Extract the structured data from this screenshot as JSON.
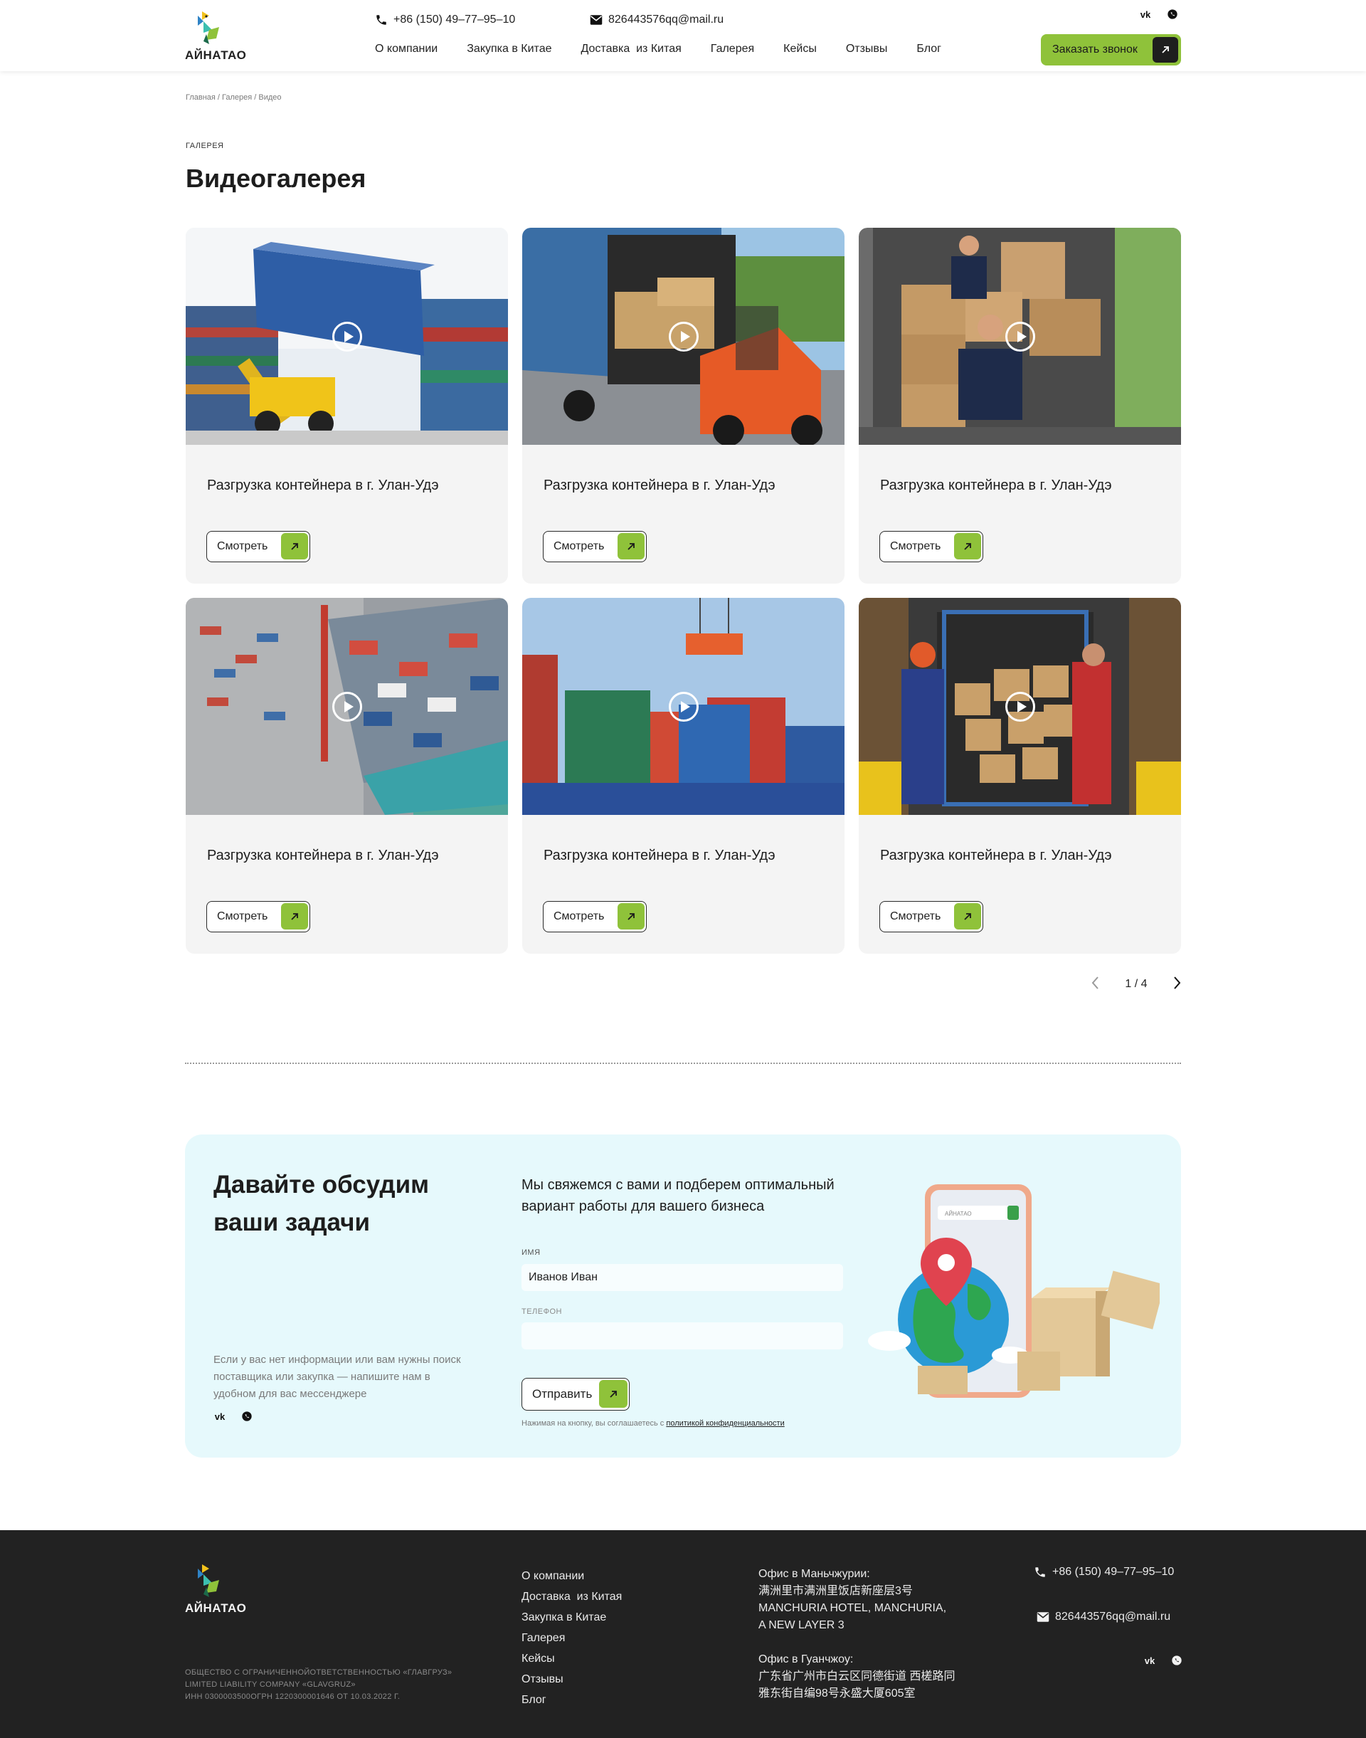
{
  "header": {
    "logo_text": "АЙНАТАО",
    "phone": "+86 (150) 49–77–95–10",
    "email": "826443576qq@mail.ru",
    "nav": [
      "О компании",
      "Закупка в Китае",
      "Доставка  из Китая",
      "Галерея",
      "Кейсы",
      "Отзывы",
      "Блог"
    ],
    "social": {
      "vk": "vk",
      "whatsapp": "whatsapp"
    },
    "cta_label": "Заказать звонок"
  },
  "breadcrumb": "Главная / Галерея / Видео",
  "section_eyebrow": "ГАЛЕРЕЯ",
  "page_title": "Видеогалерея",
  "cards": [
    {
      "title": "Разгрузка контейнера в г. Улан-Удэ",
      "button": "Смотреть",
      "image": "container-crane-loader"
    },
    {
      "title": "Разгрузка контейнера в г. Улан-Удэ",
      "button": "Смотреть",
      "image": "forklift-truck"
    },
    {
      "title": "Разгрузка контейнера в г. Улан-Удэ",
      "button": "Смотреть",
      "image": "workers-boxes-truck"
    },
    {
      "title": "Разгрузка контейнера в г. Улан-Удэ",
      "button": "Смотреть",
      "image": "container-ship-port"
    },
    {
      "title": "Разгрузка контейнера в г. Улан-Удэ",
      "button": "Смотреть",
      "image": "crane-containers"
    },
    {
      "title": "Разгрузка контейнера в г. Улан-Удэ",
      "button": "Смотреть",
      "image": "workers-cart-boxes"
    }
  ],
  "pagination": {
    "label": "1 / 4",
    "current": 1,
    "total": 4
  },
  "contact_form": {
    "title": "Давайте обсудим ваши задачи",
    "note": "Если у вас нет информации или вам нужны поиск поставщика или закупка — напишите нам в удобном для вас мессенджере",
    "lead": "Мы свяжемся с вами и подберем оптимальный вариант работы для вашего бизнеса",
    "name_label": "ИМЯ",
    "name_value": "Иванов Иван",
    "phone_label": "ТЕЛЕФОН",
    "phone_value": "",
    "submit_label": "Отправить",
    "consent_text": "Нажимая на кнопку, вы соглашаетесь с",
    "consent_link": "политикой конфиденциальности",
    "illustration_search_text": "АЙНАТАО"
  },
  "footer": {
    "logo_text": "АЙНАТАО",
    "legal": [
      "ОБЩЕСТВО С ОГРАНИЧЕННОЙОТВЕТСТВЕННОСТЬЮ «ГЛАВГРУЗ»",
      "LIMITED LIABILITY COMPANY «GLAVGRUZ»",
      "ИНН 0300003500ОГРН 1220300001646 ОТ 10.03.2022 Г."
    ],
    "nav": [
      "О компании",
      "Доставка  из Китая",
      "Закупка в Китае",
      "Галерея",
      "Кейсы",
      "Отзывы",
      "Блог"
    ],
    "office1_title": "Офис в Маньчжурии:",
    "office1_lines": [
      "满洲里市满洲里饭店新座层3号",
      "MANCHURIA HOTEL, MANCHURIA,",
      "A NEW LAYER 3"
    ],
    "office2_title": "Офис в Гуанчжоу:",
    "office2_lines": [
      "广东省广州市白云区同德街道 西槎路同",
      "雅东街自编98号永盛大厦605室"
    ],
    "phone": "+86 (150) 49–77–95–10",
    "email": "826443576qq@mail.ru"
  }
}
